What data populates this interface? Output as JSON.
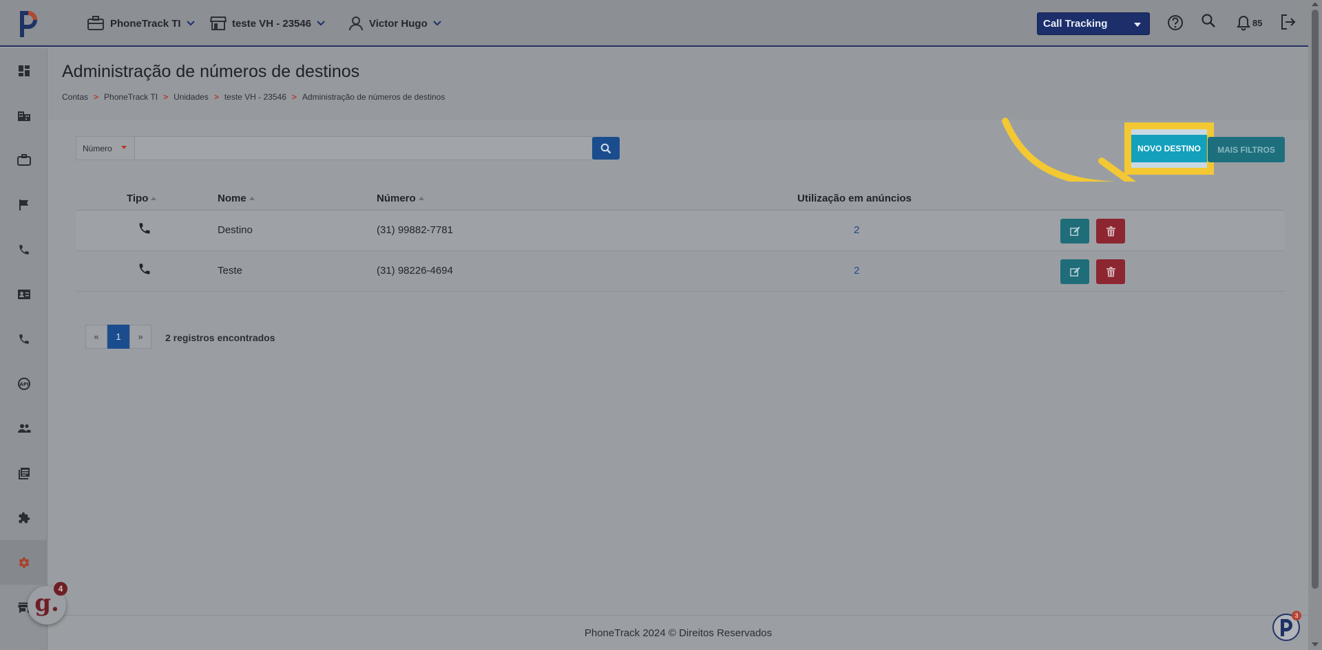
{
  "topbar": {
    "account": "PhoneTrack TI",
    "unit": "teste VH - 23546",
    "user": "Victor Hugo",
    "product_select": "Call Tracking",
    "notifications_count": "85"
  },
  "sidebar": {
    "items": [
      {
        "name": "dashboard",
        "icon": "dashboard-icon"
      },
      {
        "name": "company",
        "icon": "building-icon"
      },
      {
        "name": "briefcase",
        "icon": "briefcase-icon"
      },
      {
        "name": "campaigns",
        "icon": "flag-icon"
      },
      {
        "name": "calls",
        "icon": "phone-icon"
      },
      {
        "name": "contacts",
        "icon": "contact-card-icon"
      },
      {
        "name": "phone-numbers",
        "icon": "phone-icon"
      },
      {
        "name": "integrations",
        "icon": "plug-icon"
      },
      {
        "name": "users",
        "icon": "people-icon"
      },
      {
        "name": "reports",
        "icon": "library-icon"
      },
      {
        "name": "extensions",
        "icon": "puzzle-icon"
      },
      {
        "name": "settings",
        "icon": "gear-icon",
        "active": true
      },
      {
        "name": "store",
        "icon": "store-icon"
      }
    ]
  },
  "header": {
    "title": "Administração de números de destinos",
    "breadcrumb": [
      "Contas",
      "PhoneTrack TI",
      "Unidades",
      "teste VH - 23546",
      "Administração de números de destinos"
    ],
    "separator": ">"
  },
  "toolbar": {
    "filter_field": "Número",
    "search_placeholder": "",
    "new_button": "NOVO DESTINO",
    "filters_button": "MAIS FILTROS"
  },
  "table": {
    "columns": [
      "Tipo",
      "Nome",
      "Número",
      "Utilização em anúncios"
    ],
    "rows": [
      {
        "type_icon": "phone-icon",
        "name": "Destino",
        "number": "(31) 99882-7781",
        "usage": "2"
      },
      {
        "type_icon": "phone-icon",
        "name": "Teste",
        "number": "(31) 98226-4694",
        "usage": "2"
      }
    ]
  },
  "pagination": {
    "prev": "«",
    "current": "1",
    "next": "»",
    "info": "2 registros encontrados"
  },
  "footer": {
    "text": "PhoneTrack 2024 © Direitos Reservados"
  },
  "widgets": {
    "g_letter": "g.",
    "g_badge": "4",
    "p_badge": "3"
  },
  "colors": {
    "accent_blue": "#1b4d8e",
    "teal": "#12a0bd",
    "highlight_yellow": "#f3c833",
    "danger": "#8c2630"
  }
}
